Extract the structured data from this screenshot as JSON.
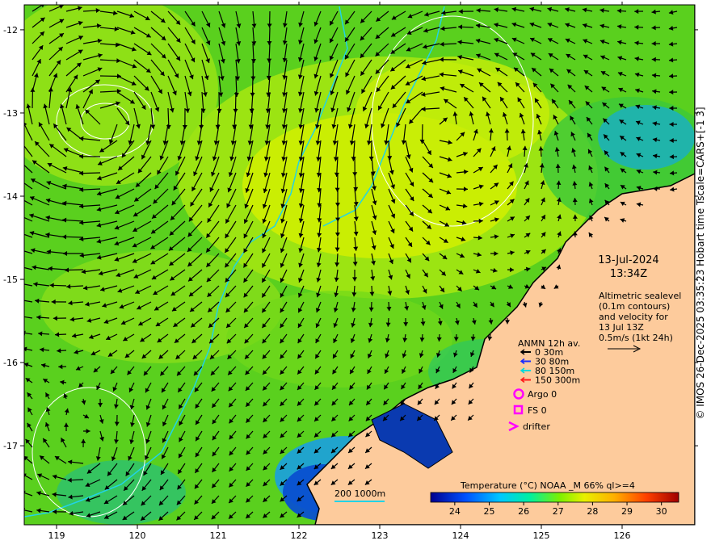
{
  "map": {
    "date": "13-Jul-2024",
    "time": "13:34Z",
    "info_lines": [
      "Altimetric sealevel",
      "(0.1m contours)",
      "and velocity for",
      "13 Jul 13Z",
      "0.5m/s (1kt 24h)"
    ],
    "legend_title": "ANMN 12h av.",
    "legend_items": [
      {
        "label": "0 30m",
        "color": "#000000"
      },
      {
        "label": "30 80m",
        "color": "#1a2cff"
      },
      {
        "label": "80 150m",
        "color": "#00d9d9"
      },
      {
        "label": "150 300m",
        "color": "#ff1a1a"
      }
    ],
    "symbols": [
      {
        "label": "Argo 0",
        "shape": "circle-icon",
        "color": "#ff00ff"
      },
      {
        "label": "FS 0",
        "shape": "square-icon",
        "color": "#ff00ff"
      },
      {
        "label": "drifter",
        "shape": "chevron-icon",
        "color": "#ff00ff"
      }
    ],
    "isobath_label": "200  1000m",
    "colorbar_title": "Temperature (°C) NOAA _M 66% ql>=4",
    "colorbar_ticks": [
      "24",
      "25",
      "26",
      "27",
      "28",
      "29",
      "30"
    ],
    "colorbar_range": [
      23.3,
      30.5
    ],
    "lon_ticks": [
      "119",
      "120",
      "121",
      "122",
      "123",
      "124",
      "125",
      "126"
    ],
    "lat_ticks": [
      "-12",
      "-13",
      "-14",
      "-15",
      "-16",
      "-17"
    ],
    "lon_range": [
      118.6,
      126.9
    ],
    "lat_range": [
      -11.7,
      -17.95
    ],
    "side_label": "© IMOS 26-Dec-2025 03:35:23 Hobart time Tscale=CARS+[-1 3]",
    "colors": {
      "land": "#fdcb9c",
      "coast": "#000000",
      "isobath": "#22d3e6",
      "contour": "#ffffff"
    }
  }
}
